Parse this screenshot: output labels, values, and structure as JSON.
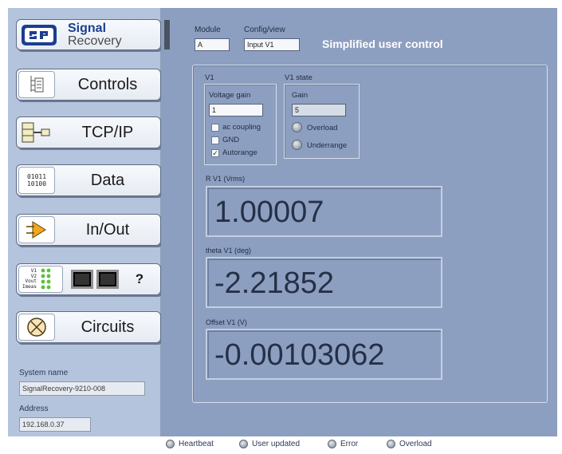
{
  "sidebar": {
    "logo": {
      "line1": "Signal",
      "line2": "Recovery"
    },
    "items": [
      {
        "label": "Controls",
        "icon": "tree-icon"
      },
      {
        "label": "TCP/IP",
        "icon": "network-icon"
      },
      {
        "label": "Data",
        "icon": "binary-data-icon",
        "icon_text": [
          "01011",
          "10100"
        ]
      },
      {
        "label": "In/Out",
        "icon": "arrow-triangle-icon"
      },
      {
        "label": "?",
        "icon": "connector-panel-icon",
        "icon_text": [
          "V1",
          "V2",
          "Vout",
          "Imeas"
        ]
      },
      {
        "label": "Circuits",
        "icon": "circle-x-icon"
      }
    ],
    "system_name_label": "System name",
    "system_name_value": "SignalRecovery-9210-008",
    "address_label": "Address",
    "address_value": "192.168.0.37"
  },
  "header": {
    "module_label": "Module",
    "module_value": "A",
    "config_label": "Config/view",
    "config_value": "Input V1",
    "title": "Simplified user control"
  },
  "v1_group": {
    "title": "V1",
    "voltage_gain_label": "Voltage gain",
    "voltage_gain_value": "1",
    "ac_coupling_label": "ac coupling",
    "gnd_label": "GND",
    "autorange_label": "Autorange",
    "ac_coupling_checked": false,
    "gnd_checked": false,
    "autorange_checked": true
  },
  "v1_state": {
    "title": "V1 state",
    "gain_label": "Gain",
    "gain_value": "5",
    "overload_label": "Overload",
    "underrange_label": "Underrange"
  },
  "readouts": {
    "r_label": "R V1 (Vrms)",
    "r_value": "1.00007",
    "theta_label": "theta V1 (deg)",
    "theta_value": "-2.21852",
    "offset_label": "Offset V1 (V)",
    "offset_value": "-0.00103062"
  },
  "status_bar": {
    "heartbeat": "Heartbeat",
    "user_updated": "User updated",
    "error": "Error",
    "overload": "Overload"
  },
  "colors": {
    "sidebar_bg": "#b4c4dc",
    "main_bg": "#8d9fc0",
    "logo_blue": "#1c3e8f",
    "arrow_orange": "#f5a623",
    "led_green": "#57c23a"
  }
}
